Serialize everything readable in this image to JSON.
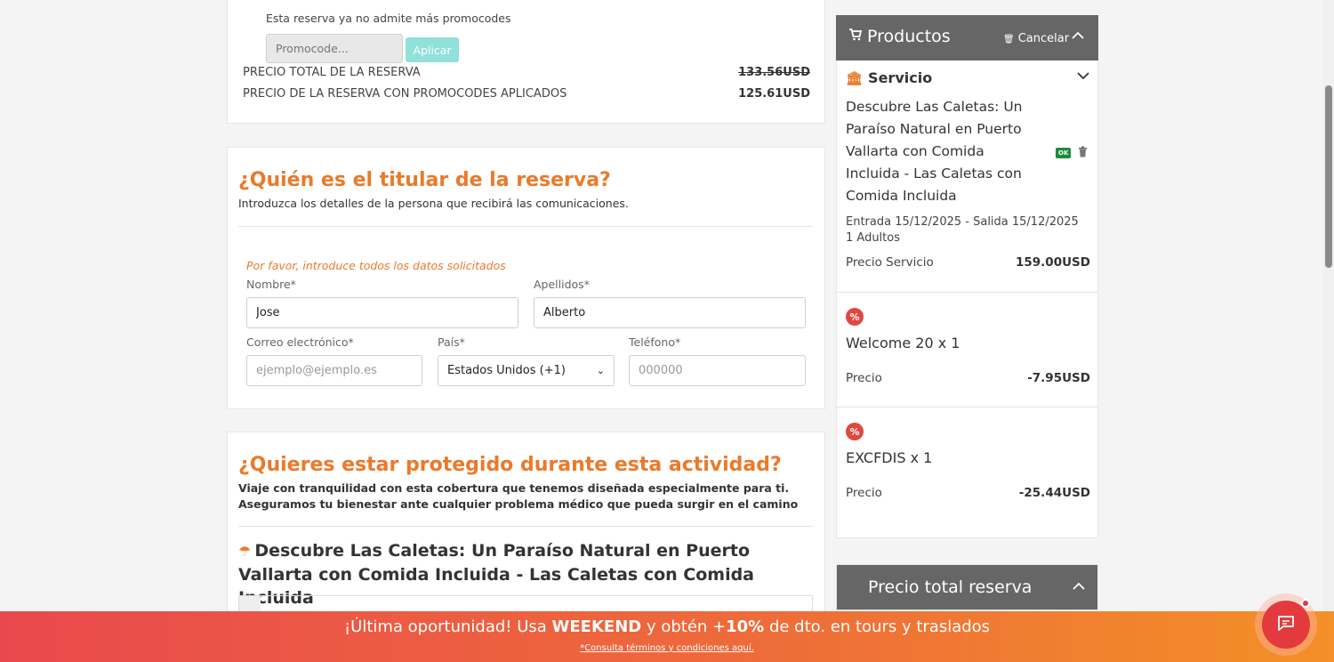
{
  "promo": {
    "note": "Esta reserva ya no admite más promocodes",
    "placeholder": "Promocode...",
    "apply_label": "Aplicar",
    "total_label": "PRECIO TOTAL DE LA RESERVA",
    "total_value": "133.56USD",
    "applied_label": "PRECIO DE LA RESERVA CON PROMOCODES APLICADOS",
    "applied_value": "125.61USD"
  },
  "holder": {
    "title": "¿Quién es el titular de la reserva?",
    "subtitle": "Introduzca los detalles de la persona que recibirá las comunicaciones.",
    "required_note": "Por favor, introduce todos los datos solicitados",
    "first_name_label": "Nombre*",
    "first_name_value": "Jose",
    "last_name_label": "Apellidos*",
    "last_name_value": "Alberto",
    "email_label": "Correo electrónico*",
    "email_placeholder": "ejemplo@ejemplo.es",
    "country_label": "País*",
    "country_value": "Estados Unidos (+1)",
    "phone_label": "Teléfono*",
    "phone_placeholder": "000000"
  },
  "insurance": {
    "title": "¿Quieres estar protegido durante esta actividad?",
    "desc_line1": "Viaje con tranquilidad con esta cobertura que tenemos diseñada especialmente para ti.",
    "desc_line2": "Aseguramos tu bienestar ante cualquier problema médico que pueda surgir en el camino",
    "activity_title": "Descubre Las Caletas: Un Paraíso Natural en Puerto Vallarta con Comida Incluida - Las Caletas con Comida Incluida"
  },
  "products": {
    "title": "Productos",
    "cancel_label": "Cancelar",
    "service_heading": "Servicio",
    "service_name": "Descubre Las Caletas: Un Paraíso Natural en Puerto Vallarta con Comida Incluida - Las Caletas con Comida Incluida",
    "ok_badge": "OK",
    "dates": "Entrada 15/12/2025 - Salida 15/12/2025",
    "guests": "1 Adultos",
    "service_price_label": "Precio Servicio",
    "service_price_value": "159.00USD",
    "discounts": [
      {
        "name": "Welcome 20 x 1",
        "price_label": "Precio",
        "price_value": "-7.95USD"
      },
      {
        "name": "EXCFDIS x 1",
        "price_label": "Precio",
        "price_value": "-25.44USD"
      }
    ]
  },
  "total_panel": {
    "title": "Precio total reserva"
  },
  "banner": {
    "pre": "¡Última oportunidad! Usa ",
    "code": "WEEKEND",
    "mid": " y obtén +",
    "pct": "10%",
    "post": " de dto. en tours y traslados",
    "fine": "*Consulta términos y condiciones aquí."
  },
  "colors": {
    "accent": "#e97a2b",
    "panel_header": "#666666",
    "discount_badge": "#e0483f"
  }
}
